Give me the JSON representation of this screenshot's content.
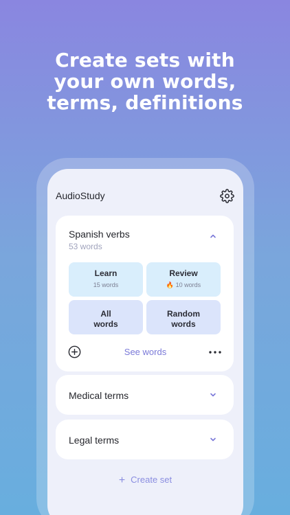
{
  "headline": {
    "line1": "Create sets with",
    "line2": "your own words,",
    "line3": "terms, definitions"
  },
  "app": {
    "title": "AudioStudy",
    "settings_icon": "gear-icon"
  },
  "sets": [
    {
      "name": "Spanish verbs",
      "count": "53 words",
      "expanded": true,
      "tiles": [
        {
          "label": "Learn",
          "sub": "15 words"
        },
        {
          "label": "Review",
          "sub": "🔥 10 words"
        },
        {
          "label_line1": "All",
          "label_line2": "words"
        },
        {
          "label_line1": "Random",
          "label_line2": "words"
        }
      ],
      "see_words": "See words"
    },
    {
      "name": "Medical terms",
      "expanded": false
    },
    {
      "name": "Legal terms",
      "expanded": false
    }
  ],
  "create_set": {
    "label": "Create set"
  },
  "colors": {
    "accent": "#7a79d8",
    "tile_blue": "#d9eefc",
    "tile_lavender": "#dbe4fb",
    "screen_bg": "#eef0fa"
  }
}
